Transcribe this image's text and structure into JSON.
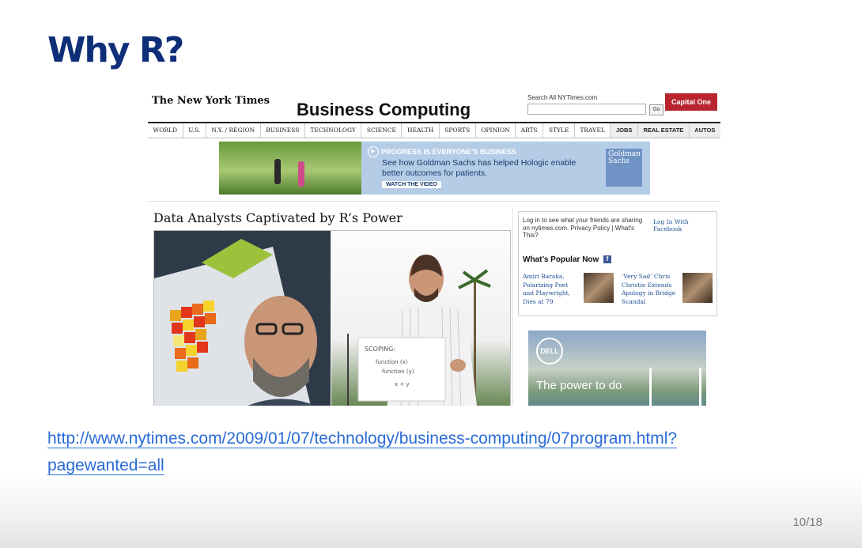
{
  "slide": {
    "title": "Why R?",
    "link_line1": "http://www.nytimes.com/2009/01/07/technology/business-computing/07program.html?",
    "link_line2": "pagewanted=all",
    "page_number": "10/18"
  },
  "nyt": {
    "logo": "The New York Times",
    "section": "Business Computing",
    "search_label": "Search All NYTimes.com",
    "search_button": "Go",
    "sponsor": "Capital One",
    "nav": [
      "WORLD",
      "U.S.",
      "N.Y. / REGION",
      "BUSINESS",
      "TECHNOLOGY",
      "SCIENCE",
      "HEALTH",
      "SPORTS",
      "OPINION",
      "ARTS",
      "STYLE",
      "TRAVEL",
      "JOBS",
      "REAL ESTATE",
      "AUTOS"
    ],
    "ad": {
      "headline": "PROGRESS IS EVERYONE'S BUSINESS",
      "body": "See how Goldman Sachs has helped Hologic enable better outcomes for patients.",
      "cta": "WATCH THE VIDEO",
      "brand": "Goldman Sachs"
    },
    "article_headline": "Data Analysts Captivated by R’s Power",
    "sidebar": {
      "login_text": "Log in to see what your friends are sharing on nytimes.com. Privacy Policy | What's This?",
      "login_link": "Log In With Facebook",
      "popular_title": "What’s Popular Now",
      "items": [
        "Amiri Baraka, Polarizing Poet and Playwright, Dies at 79",
        "‘Very Sad’ Chris Christie Extends Apology in Bridge Scandal"
      ]
    },
    "dell_ad": {
      "brand": "DELL",
      "slogan": "The power to do"
    },
    "whiteboard_text": [
      "SCOPING:",
      "function (x)",
      "function (y)",
      "x + y"
    ]
  },
  "colors": {
    "title": "#0f2e78",
    "link": "#2a6bd6",
    "sponsor": "#b8252f"
  }
}
